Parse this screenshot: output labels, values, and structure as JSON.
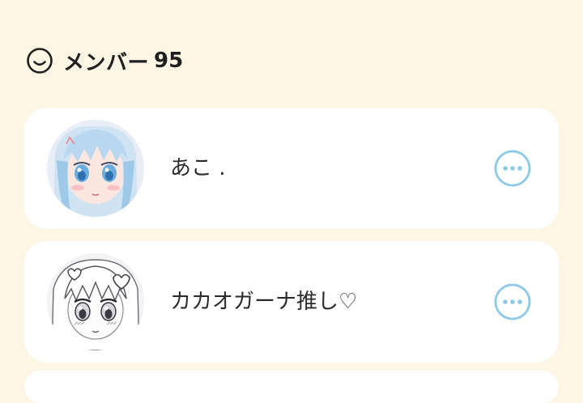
{
  "members_section": {
    "icon": "smiley-outline-icon",
    "title": "メンバー",
    "count": "95"
  },
  "members": [
    {
      "name": "あこ .",
      "avatar": "anime-girl-blue-hair-avatar",
      "more_icon": "more-options-icon"
    },
    {
      "name": "カカオガーナ推し♡",
      "avatar": "anime-girl-monochrome-sketch-avatar",
      "more_icon": "more-options-icon"
    }
  ],
  "colors": {
    "background": "#fdf6e4",
    "card": "#ffffff",
    "accent": "#8ec9e6",
    "text": "#222222"
  }
}
